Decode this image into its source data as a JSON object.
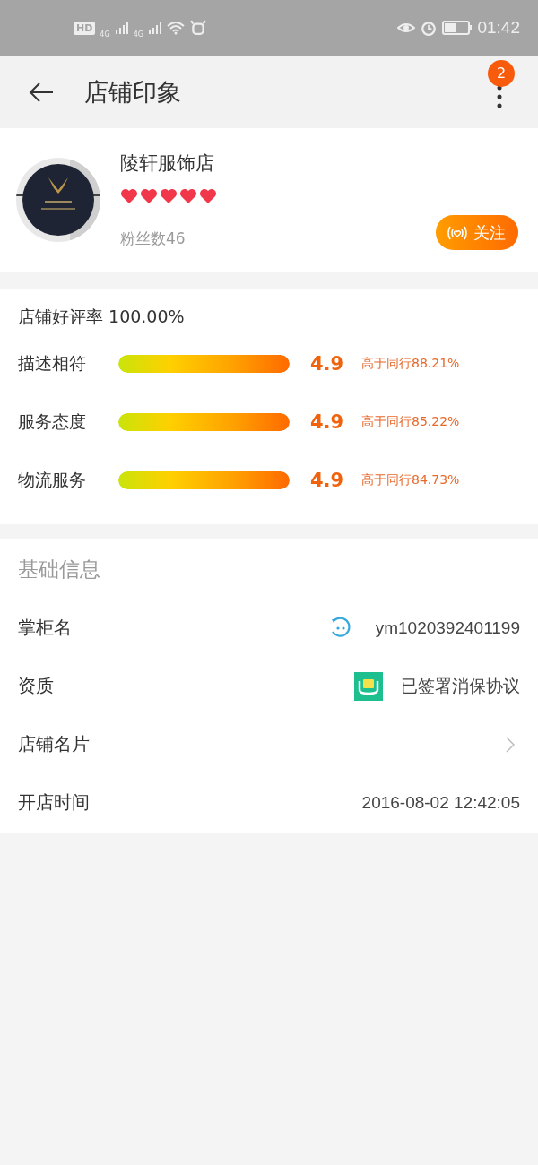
{
  "status_bar": {
    "indicators": [
      "HD",
      "4G",
      "4G"
    ],
    "time": "01:42"
  },
  "header": {
    "title": "店铺印象",
    "badge": "2"
  },
  "shop": {
    "name": "陵轩服饰店",
    "stars": 5,
    "fans": "粉丝数46",
    "follow_button": "关注"
  },
  "ratings": {
    "title": "店铺好评率 100.00%",
    "items": [
      {
        "label": "描述相符",
        "level": 1,
        "score": "4.9",
        "compare": "高于同行88.21%"
      },
      {
        "label": "服务态度",
        "level": 1,
        "score": "4.9",
        "compare": "高于同行85.22%"
      },
      {
        "label": "物流服务",
        "level": 1,
        "score": "4.9",
        "compare": "高于同行84.73%"
      }
    ]
  },
  "basic_info": {
    "title": "基础信息",
    "rows": [
      {
        "kind": "chat",
        "label": "掌柜名",
        "value": "ym1020392401199"
      },
      {
        "kind": "badge",
        "label": "资质",
        "value": "已签署消保协议"
      },
      {
        "kind": "link",
        "label": "店铺名片"
      },
      {
        "kind": "plain",
        "label": "开店时间",
        "value": "2016-08-02 12:42:05"
      }
    ]
  }
}
